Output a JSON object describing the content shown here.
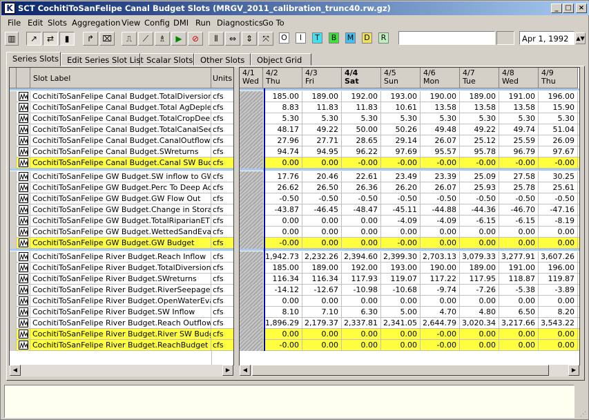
{
  "window": {
    "title": "SCT CochitiToSanFelipe Canal Budget Slots (MRGV_2011_calibration_trunc40.rw.gz)",
    "app_icon": "K"
  },
  "menu": [
    "File",
    "Edit",
    "Slots",
    "Aggregation",
    "View",
    "Config",
    "DMI",
    "Run",
    "Diagnostics",
    "Go To"
  ],
  "toolbar": {
    "letters": [
      "O",
      "I",
      "T",
      "B",
      "M",
      "D",
      "R"
    ],
    "date": "Apr 1, 1992"
  },
  "tabs": [
    "Series Slots",
    "Edit Series Slot List",
    "Scalar Slots",
    "Other Slots",
    "Object Grid"
  ],
  "colors": {
    "highlight": "#ffff40",
    "separator": "#a6caf0",
    "title_start": "#0a246a",
    "letterT": "#40e0f0",
    "letterB": "#40e040",
    "letterM": "#40c0f0",
    "letterD": "#f0e060",
    "letterR": "#c0f0c0"
  },
  "table": {
    "slot_header": "Slot Label",
    "units_header": "Units",
    "dates": [
      {
        "d": "4/1",
        "w": "Wed"
      },
      {
        "d": "4/2",
        "w": "Thu"
      },
      {
        "d": "4/3",
        "w": "Fri"
      },
      {
        "d": "4/4",
        "w": "Sat"
      },
      {
        "d": "4/5",
        "w": "Sun"
      },
      {
        "d": "4/6",
        "w": "Mon"
      },
      {
        "d": "4/7",
        "w": "Tue"
      },
      {
        "d": "4/8",
        "w": "Wed"
      },
      {
        "d": "4/9",
        "w": "Thu"
      }
    ],
    "groups": [
      {
        "rows": [
          {
            "label": "CochitiToSanFelipe Canal Budget.TotalDiversion",
            "units": "cfs",
            "v": [
              "185.00",
              "189.00",
              "192.00",
              "193.00",
              "190.00",
              "189.00",
              "191.00",
              "196.00"
            ]
          },
          {
            "label": "CochitiToSanFelipe Canal Budget.Total AgDepletions",
            "units": "cfs",
            "v": [
              "8.83",
              "11.83",
              "11.83",
              "10.61",
              "13.58",
              "13.58",
              "13.58",
              "15.90"
            ]
          },
          {
            "label": "CochitiToSanFelipe Canal Budget.TotalCropDeepPerc",
            "units": "cfs",
            "v": [
              "5.30",
              "5.30",
              "5.30",
              "5.30",
              "5.30",
              "5.30",
              "5.30",
              "5.30"
            ]
          },
          {
            "label": "CochitiToSanFelipe Canal Budget.TotalCanalSeepage",
            "units": "cfs",
            "v": [
              "48.17",
              "49.22",
              "50.00",
              "50.26",
              "49.48",
              "49.22",
              "49.74",
              "51.04"
            ]
          },
          {
            "label": "CochitiToSanFelipe Canal Budget.CanalOutflow",
            "units": "cfs",
            "v": [
              "27.96",
              "27.71",
              "28.65",
              "29.14",
              "26.07",
              "25.12",
              "25.59",
              "26.09"
            ]
          },
          {
            "label": "CochitiToSanFelipe Canal Budget.SWreturns",
            "units": "cfs",
            "v": [
              "94.74",
              "94.95",
              "96.22",
              "97.69",
              "95.57",
              "95.78",
              "96.79",
              "97.67"
            ]
          },
          {
            "label": "CochitiToSanFelipe Canal Budget.Canal SW Budget",
            "units": "cfs",
            "hl": true,
            "v": [
              "0.00",
              "0.00",
              "-0.00",
              "-0.00",
              "-0.00",
              "-0.00",
              "-0.00",
              "-0.00"
            ]
          }
        ]
      },
      {
        "rows": [
          {
            "label": "CochitiToSanFelipe GW Budget.SW inflow to GW",
            "units": "cfs",
            "v": [
              "17.76",
              "20.46",
              "22.61",
              "23.49",
              "23.39",
              "25.09",
              "27.58",
              "30.25"
            ]
          },
          {
            "label": "CochitiToSanFelipe GW Budget.Perc To Deep Aquifer",
            "units": "cfs",
            "v": [
              "26.62",
              "26.50",
              "26.36",
              "26.20",
              "26.07",
              "25.93",
              "25.78",
              "25.61"
            ]
          },
          {
            "label": "CochitiToSanFelipe GW Budget.GW Flow Out",
            "units": "cfs",
            "v": [
              "-0.50",
              "-0.50",
              "-0.50",
              "-0.50",
              "-0.50",
              "-0.50",
              "-0.50",
              "-0.50"
            ]
          },
          {
            "label": "CochitiToSanFelipe GW Budget.Change in Storage",
            "units": "cfs",
            "v": [
              "-43.87",
              "-46.45",
              "-48.47",
              "-45.11",
              "-44.88",
              "-44.36",
              "-46.70",
              "-47.16"
            ]
          },
          {
            "label": "CochitiToSanFelipe GW Budget.TotalRiparianET",
            "units": "cfs",
            "v": [
              "0.00",
              "0.00",
              "0.00",
              "-4.09",
              "-4.09",
              "-6.15",
              "-6.15",
              "-8.19"
            ]
          },
          {
            "label": "CochitiToSanFelipe GW Budget.WettedSandEvap",
            "units": "cfs",
            "v": [
              "0.00",
              "0.00",
              "0.00",
              "0.00",
              "0.00",
              "0.00",
              "0.00",
              "0.00"
            ]
          },
          {
            "label": "CochitiToSanFelipe GW Budget.GW Budget",
            "units": "cfs",
            "hl": true,
            "v": [
              "-0.00",
              "0.00",
              "0.00",
              "-0.00",
              "0.00",
              "0.00",
              "0.00",
              "0.00"
            ]
          }
        ]
      },
      {
        "rows": [
          {
            "label": "CochitiToSanFelipe River Budget.Reach Inflow",
            "units": "cfs",
            "v": [
              "1,942.73",
              "2,232.26",
              "2,394.60",
              "2,399.30",
              "2,703.13",
              "3,079.33",
              "3,277.91",
              "3,607.26"
            ]
          },
          {
            "label": "CochitiToSanFelipe River Budget.TotalDiversion",
            "units": "cfs",
            "v": [
              "185.00",
              "189.00",
              "192.00",
              "193.00",
              "190.00",
              "189.00",
              "191.00",
              "196.00"
            ]
          },
          {
            "label": "CochitiToSanFelipe River Budget.SWreturns",
            "units": "cfs",
            "v": [
              "116.34",
              "116.34",
              "117.93",
              "119.07",
              "117.22",
              "117.95",
              "118.87",
              "119.87"
            ]
          },
          {
            "label": "CochitiToSanFelipe River Budget.RiverSeepage",
            "units": "cfs",
            "v": [
              "-14.12",
              "-12.67",
              "-10.98",
              "-10.68",
              "-9.74",
              "-7.26",
              "-5.38",
              "-3.89"
            ]
          },
          {
            "label": "CochitiToSanFelipe River Budget.OpenWaterEvap",
            "units": "cfs",
            "v": [
              "0.00",
              "0.00",
              "0.00",
              "0.00",
              "0.00",
              "0.00",
              "0.00",
              "0.00"
            ]
          },
          {
            "label": "CochitiToSanFelipe River Budget.SW Inflow",
            "units": "cfs",
            "v": [
              "8.10",
              "7.10",
              "6.30",
              "5.00",
              "4.70",
              "4.80",
              "6.50",
              "8.20"
            ]
          },
          {
            "label": "CochitiToSanFelipe River Budget.Reach Outflow",
            "units": "cfs",
            "v": [
              "1,896.29",
              "2,179.37",
              "2,337.81",
              "2,341.05",
              "2,644.79",
              "3,020.34",
              "3,217.66",
              "3,543.22"
            ]
          },
          {
            "label": "CochitiToSanFelipe River Budget.River SW Budget",
            "units": "cfs",
            "hl": true,
            "v": [
              "0.00",
              "0.00",
              "0.00",
              "0.00",
              "-0.00",
              "0.00",
              "0.00",
              "0.00"
            ]
          },
          {
            "label": "CochitiToSanFelipe River Budget.ReachBudget",
            "units": "cfs",
            "hl": true,
            "v": [
              "-0.00",
              "0.00",
              "0.00",
              "0.00",
              "-0.00",
              "0.00",
              "0.00",
              "0.00"
            ]
          }
        ]
      }
    ]
  }
}
